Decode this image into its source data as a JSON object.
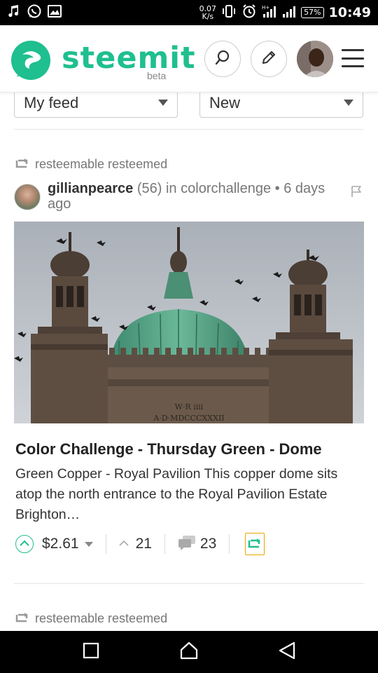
{
  "status_bar": {
    "net_speed_value": "0.07",
    "net_speed_unit": "K/s",
    "battery": "57%",
    "time": "10:49"
  },
  "header": {
    "brand": "steemit",
    "brand_sub": "beta",
    "brand_color": "#1fbf8f"
  },
  "filters": {
    "feed_select": "My feed",
    "sort_select": "New"
  },
  "posts": [
    {
      "resteem_label": "resteemable resteemed",
      "author": "gillianpearce",
      "reputation": "(56)",
      "category_prefix": "in",
      "category": "colorchallenge",
      "time_ago": "• 6 days ago",
      "image_caption_line1": "W·R iiii",
      "image_caption_line2": "A·D·MDCCCXXXII",
      "title": "Color Challenge - Thursday Green - Dome",
      "excerpt": "Green Copper - Royal Pavilion This copper dome sits atop the north entrance to the Royal Pavilion Estate Brighton…",
      "payout": "$2.61",
      "votes": "21",
      "comments": "23"
    },
    {
      "resteem_label": "resteemable resteemed"
    }
  ],
  "icons": {
    "search": "search-icon",
    "edit": "pencil-icon",
    "menu": "hamburger-icon",
    "flag": "flag-icon",
    "upvote": "chevron-up-icon",
    "resteem": "resteem-icon",
    "comments": "comments-icon",
    "nav_recent": "square-icon",
    "nav_home": "home-icon",
    "nav_back": "back-triangle-icon"
  }
}
